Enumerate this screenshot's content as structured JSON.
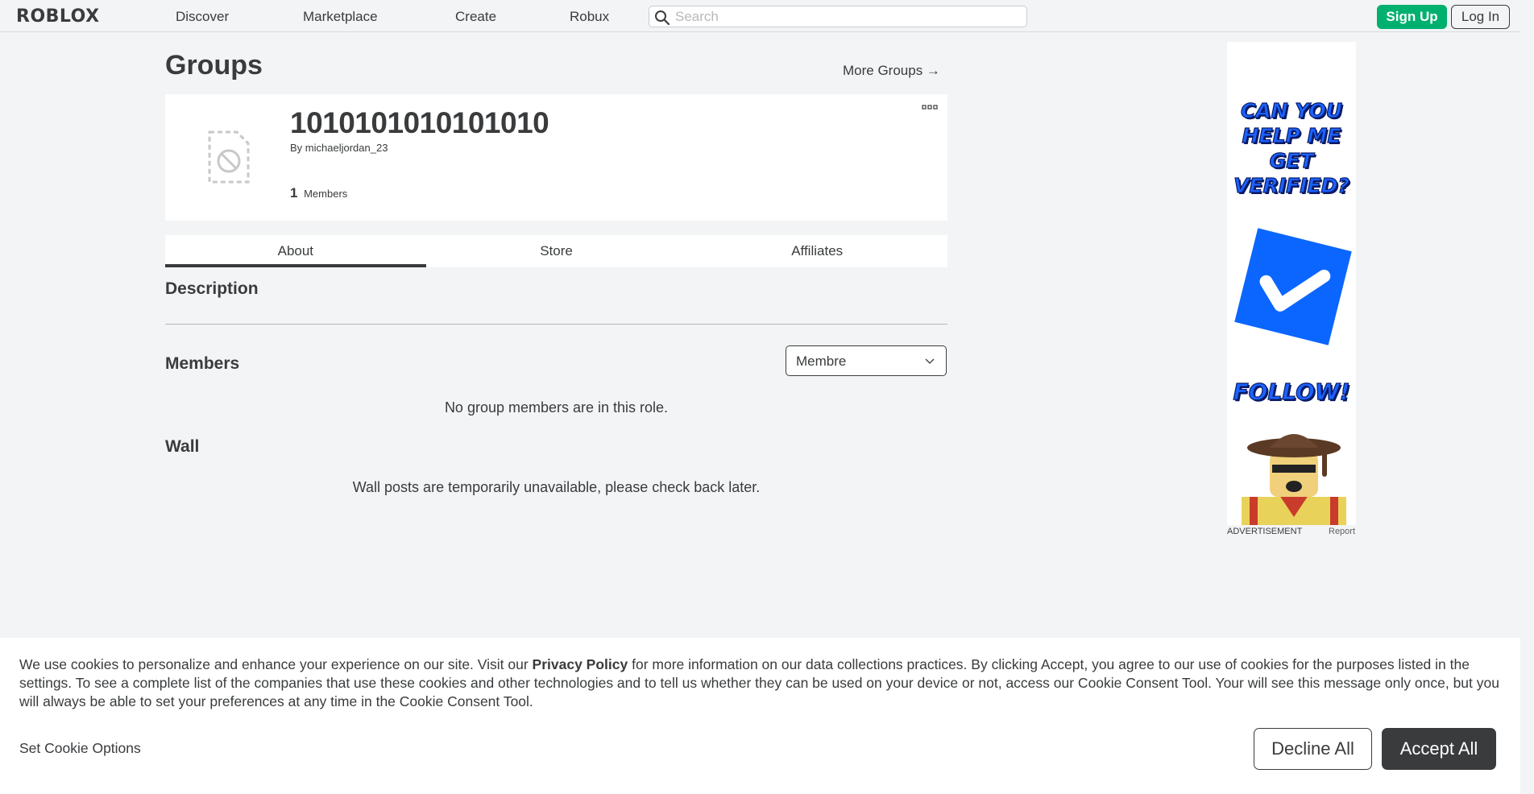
{
  "header": {
    "logo": "ROBLOX",
    "nav": [
      "Discover",
      "Marketplace",
      "Create",
      "Robux"
    ],
    "search_placeholder": "Search",
    "signup_label": "Sign Up",
    "login_label": "Log In"
  },
  "page": {
    "title": "Groups",
    "more_groups": "More Groups →"
  },
  "group": {
    "name": "1010101010101010",
    "by_prefix": "By",
    "owner": "michaeljordan_23",
    "member_count": "1",
    "members_label": "Members"
  },
  "tabs": [
    "About",
    "Store",
    "Affiliates"
  ],
  "about": {
    "description_title": "Description",
    "members_title": "Members",
    "role_selected": "Membre",
    "members_empty": "No group members are in this role.",
    "wall_title": "Wall",
    "wall_message": "Wall posts are temporarily unavailable, please check back later."
  },
  "ad": {
    "headline_lines": [
      "CAN YOU",
      "HELP ME",
      "GET",
      "VERIFIED?"
    ],
    "follow": "FOLLOW!",
    "label": "ADVERTISEMENT",
    "report": "Report"
  },
  "cookie": {
    "text_before": "We use cookies to personalize and enhance your experience on our site. Visit our ",
    "privacy_link": "Privacy Policy",
    "text_after": " for more information on our data collections practices. By clicking Accept, you agree to our use of cookies for the purposes listed in the settings. To see a complete list of the companies that use these cookies and other technologies and to tell us whether they can be used on your device or not, access our Cookie Consent Tool. Your will see this message only once, but you will always be able to set your preferences at any time in the Cookie Consent Tool.",
    "set_options": "Set Cookie Options",
    "decline": "Decline All",
    "accept": "Accept All"
  },
  "colors": {
    "signup": "#00b06f",
    "ad_blue": "#1b63ff",
    "text": "#393b3d",
    "background": "#f2f4f5"
  },
  "icons": {
    "search": "search-icon",
    "group_emblem": "blocked-image-icon",
    "more": "more-options-icon",
    "chevron": "chevron-down-icon"
  }
}
